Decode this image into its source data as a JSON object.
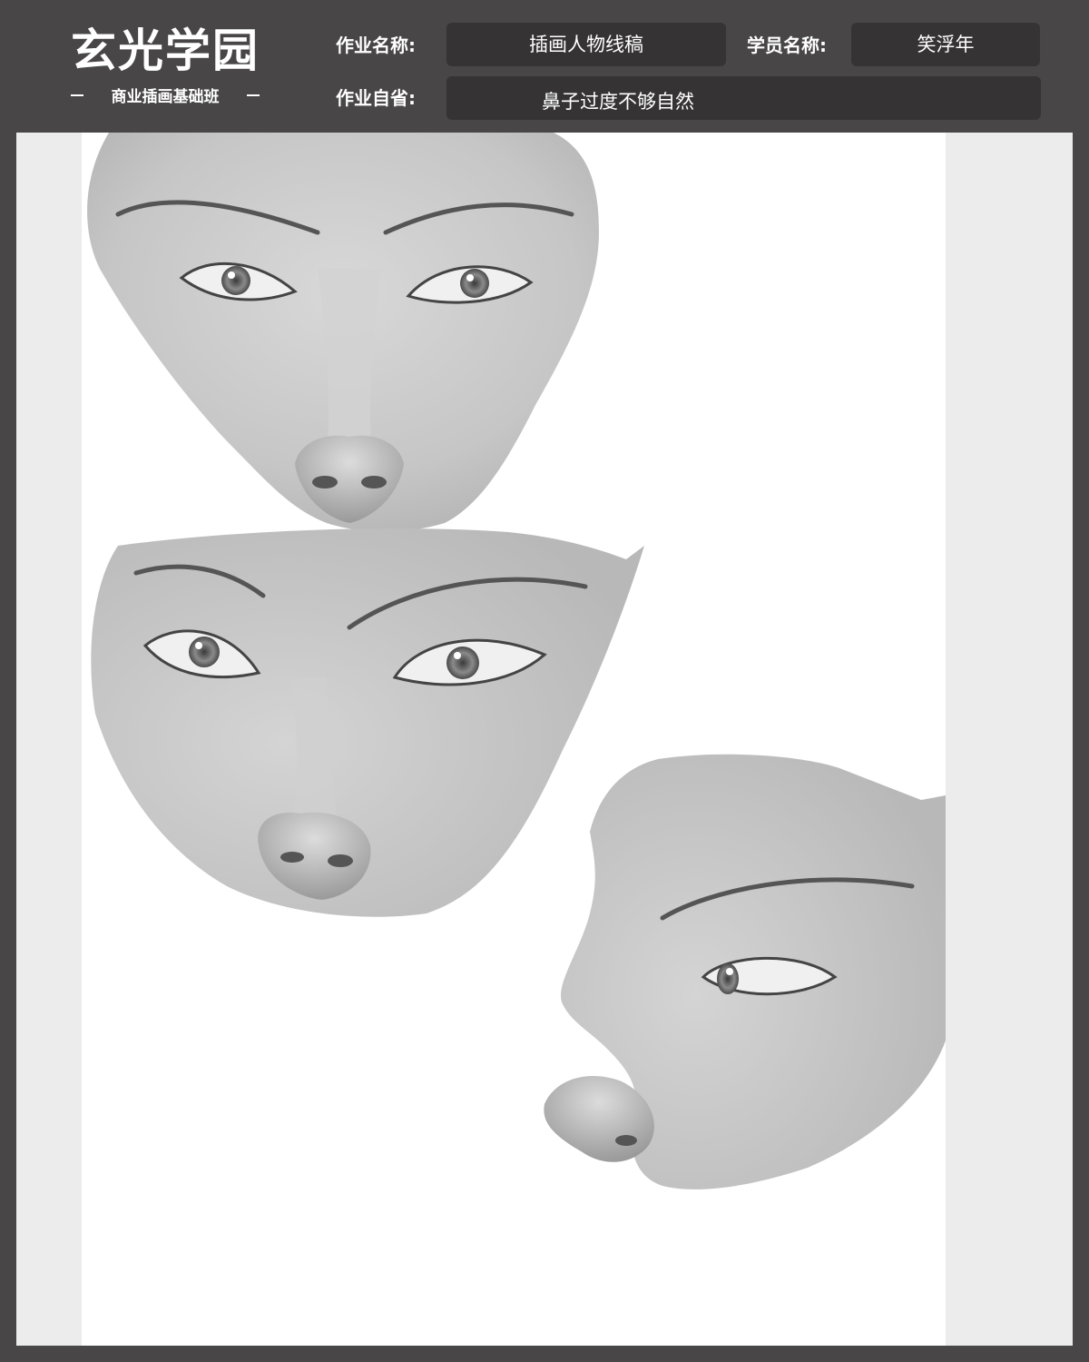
{
  "logo": {
    "title": "玄光学园",
    "subtitle": "商业插画基础班"
  },
  "form": {
    "assignment_name_label": "作业名称:",
    "assignment_name_value": "插画人物线稿",
    "student_name_label": "学员名称:",
    "student_name_value": "笑浮年",
    "self_review_label": "作业自省:",
    "self_review_value": "鼻子过度不够自然"
  }
}
